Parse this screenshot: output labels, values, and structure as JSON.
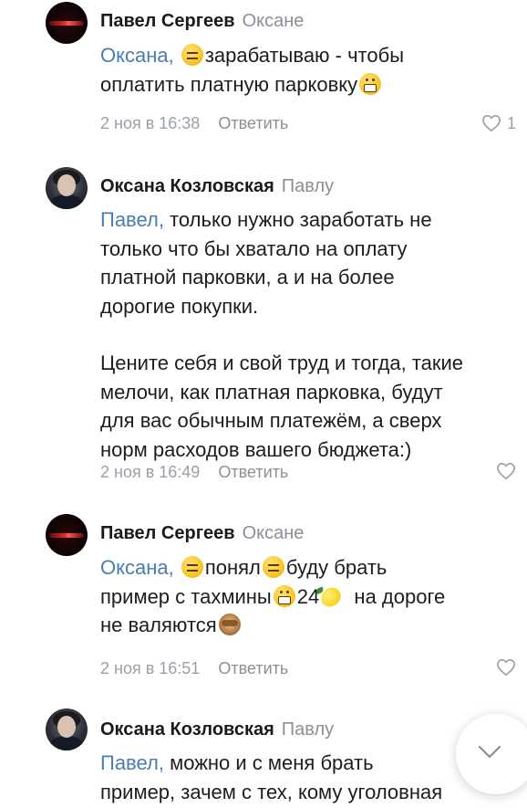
{
  "comments": [
    {
      "author": "Павел Сергеев",
      "reply_to": "Оксане",
      "text": {
        "mention": "Оксана,",
        "part1": "зарабатываю - чтобы",
        "line2": "оплатить платную парковку"
      },
      "meta": {
        "date": "2 ноя в 16:38",
        "reply_label": "Ответить"
      },
      "likes": "1"
    },
    {
      "author": "Оксана Козловская",
      "reply_to": "Павлу",
      "text": {
        "mention": "Павел,",
        "part1": "только нужно заработать не",
        "lines": [
          "только что бы хватало на оплату",
          "платной парковки, а и на более",
          "дорогие покупки."
        ],
        "paragraph2": [
          "Цените себя и свой труд и тогда, такие",
          "мелочи, как платная парковка, будут",
          "для вас обычным платежём, а сверх",
          "норм расходов вашего бюджета:)"
        ]
      },
      "meta": {
        "date": "2 ноя в 16:49",
        "reply_label": "Ответить"
      }
    },
    {
      "author": "Павел Сергеев",
      "reply_to": "Оксане",
      "text": {
        "mention": "Оксана,",
        "part1": "понял",
        "part2": "буду брать",
        "line2a": "пример с тахмины",
        "line2b": "24",
        "line2c": "на дороге",
        "line3": "не валяются"
      },
      "meta": {
        "date": "2 ноя в 16:51",
        "reply_label": "Ответить"
      }
    },
    {
      "author": "Оксана Козловская",
      "reply_to": "Павлу",
      "text": {
        "mention": "Павел,",
        "part1": "можно и с меня брать",
        "line2": "пример, зачем с тех, кому уголовная"
      }
    }
  ],
  "icons": {
    "heart": "heart-outline-icon",
    "scroll": "chevron-down-icon"
  },
  "colors": {
    "link": "#4a7db3",
    "muted": "#9aa0a8",
    "text": "#1d1d1f"
  }
}
